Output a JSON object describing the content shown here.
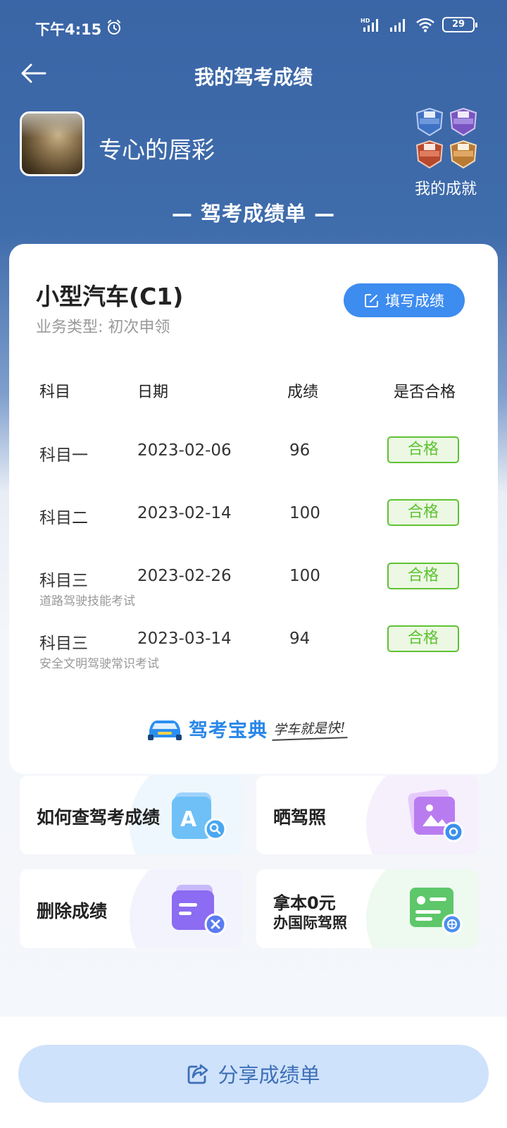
{
  "status": {
    "time": "下午4:15",
    "battery": "29"
  },
  "header": {
    "title": "我的驾考成绩"
  },
  "profile": {
    "username": "专心的唇彩",
    "achievement_label": "我的成就"
  },
  "section_heading": "— 驾考成绩单 —",
  "card": {
    "license_type": "小型汽车(C1)",
    "business_type": "业务类型: 初次申领",
    "fill_button": "填写成绩",
    "columns": {
      "subject": "科目",
      "date": "日期",
      "score": "成绩",
      "pass": "是否合格"
    },
    "rows": [
      {
        "subject": "科目一",
        "note": "",
        "date": "2023-02-06",
        "score": "96",
        "result": "合格"
      },
      {
        "subject": "科目二",
        "note": "",
        "date": "2023-02-14",
        "score": "100",
        "result": "合格"
      },
      {
        "subject": "科目三",
        "note": "道路驾驶技能考试",
        "date": "2023-02-26",
        "score": "100",
        "result": "合格"
      },
      {
        "subject": "科目三",
        "note": "安全文明驾驶常识考试",
        "date": "2023-03-14",
        "score": "94",
        "result": "合格"
      }
    ],
    "brand_name": "驾考宝典",
    "brand_slogan": "学车就是快!"
  },
  "tiles": {
    "check_scores": "如何查驾考成绩",
    "show_license": "晒驾照",
    "delete_scores": "删除成绩",
    "intl_license_line1": "拿本0元",
    "intl_license_line2": "办国际驾照"
  },
  "share_button": "分享成绩单",
  "colors": {
    "header_blue": "#3a65a6",
    "accent_blue": "#3d8cf0",
    "pass_green": "#5fc234"
  }
}
